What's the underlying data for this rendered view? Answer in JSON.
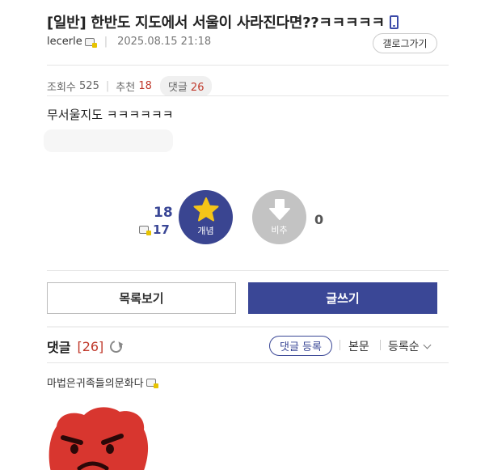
{
  "post": {
    "title": "[일반] 한반도 지도에서 서울이 사라진다면??ㅋㅋㅋㅋㅋ",
    "author": "lecerle",
    "date": "2025.08.15 21:18",
    "gallery_button": "갤로그가기",
    "views_label": "조회수",
    "views": "525",
    "recommend_label": "추천",
    "recommend": "18",
    "comments_label": "댓글",
    "comments": "26",
    "body": "무서울지도 ㅋㅋㅋㅋㅋㅋ"
  },
  "votes": {
    "up_count": "18",
    "up_fixed_count": "17",
    "up_label": "개념",
    "down_label": "비추",
    "down_count": "0"
  },
  "actions": {
    "list_label": "목록보기",
    "write_label": "글쓰기"
  },
  "comments": {
    "title": "댓글",
    "count": "[26]",
    "write_label": "댓글 등록",
    "body_label": "본문",
    "sort_label": "등록순",
    "first_author": "마법은귀족들의문화다"
  },
  "colors": {
    "accent": "#3a4796",
    "highlight": "#c0392b",
    "star": "#f5c518",
    "downvote": "#c3c3c3"
  },
  "icons": [
    "phone-icon",
    "fixed-user-icon",
    "star-icon",
    "down-arrow-icon",
    "refresh-icon",
    "chevron-down-icon",
    "angry-emoji"
  ]
}
